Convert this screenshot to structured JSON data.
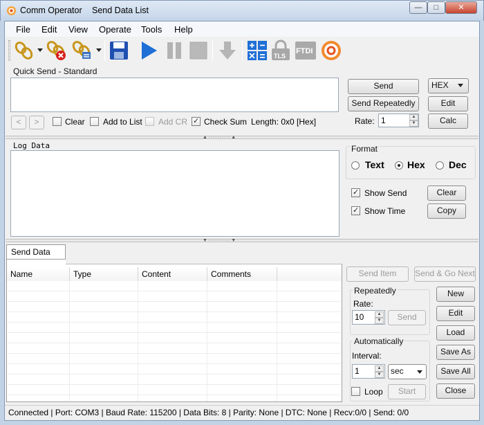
{
  "window": {
    "app_title": "Comm Operator",
    "doc_title": "Send Data List",
    "minimize": "—",
    "maximize": "□",
    "close": "✕"
  },
  "menu": [
    "File",
    "Edit",
    "View",
    "Operate",
    "Tools",
    "Help"
  ],
  "toolbar": {
    "icons": [
      "connect-icon",
      "disconnect-icon",
      "connect-options-icon",
      "save-icon",
      "play-icon",
      "pause-icon",
      "stop-icon",
      "download-icon",
      "calculator-icon",
      "tls-icon",
      "ftdi-icon",
      "logo-icon"
    ],
    "tls_label": "TLS",
    "ftdi_label": "FTDI"
  },
  "quick_send": {
    "title": "Quick Send - Standard",
    "nav_prev": "<",
    "nav_next": ">",
    "clear_label": "Clear",
    "add_to_list_label": "Add to List",
    "add_cr_label": "Add CR",
    "check_sum_label": "Check Sum",
    "clear_checked": false,
    "add_to_list_checked": false,
    "add_cr_checked": false,
    "check_sum_checked": true,
    "length_text": "Length: 0x0 [Hex]",
    "send_button": "Send",
    "send_repeatedly_button": "Send Repeatedly",
    "rate_label": "Rate:",
    "rate_value": "1",
    "format_select": "HEX",
    "edit_button": "Edit",
    "calc_button": "Calc"
  },
  "log": {
    "title": "Log Data",
    "format_title": "Format",
    "format_options": [
      "Text",
      "Hex",
      "Dec"
    ],
    "format_selected": "Hex",
    "show_send_label": "Show Send",
    "show_time_label": "Show Time",
    "show_send_checked": true,
    "show_time_checked": true,
    "clear_button": "Clear",
    "copy_button": "Copy"
  },
  "send_list": {
    "tab_label": "Send Data List",
    "columns": [
      "Name",
      "Type",
      "Content",
      "Comments"
    ],
    "send_item_button": "Send Item",
    "send_go_next_button": "Send & Go Next",
    "repeatedly_title": "Repeatedly",
    "rate_label": "Rate:",
    "rate_value": "10",
    "send_button": "Send",
    "automatically_title": "Automatically",
    "interval_label": "Interval:",
    "interval_value": "1",
    "interval_unit": "sec",
    "loop_label": "Loop",
    "loop_checked": false,
    "start_button": "Start",
    "new_button": "New",
    "edit_button": "Edit",
    "load_button": "Load",
    "save_as_button": "Save As",
    "save_all_button": "Save All",
    "close_button": "Close"
  },
  "status": {
    "text": "Connected | Port: COM3 | Baud Rate: 115200 | Data Bits: 8 | Parity: None | DTC: None | Recv:0/0 | Send: 0/0"
  }
}
